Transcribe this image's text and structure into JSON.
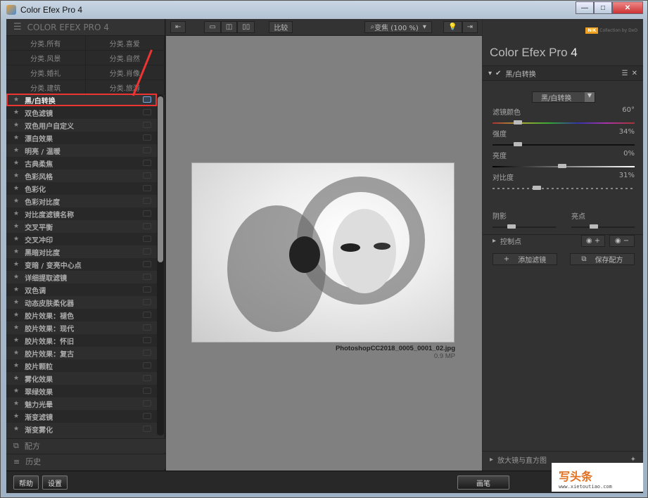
{
  "window": {
    "title": "Color Efex Pro 4",
    "minimize": "—",
    "maximize": "□",
    "close": "✕"
  },
  "left": {
    "header": "COLOR EFEX PRO 4",
    "categories": [
      "分类.所有",
      "分类.喜爱",
      "分类.风景",
      "分类.自然",
      "分类.婚礼",
      "分类.肖像",
      "分类.建筑",
      "分类.旅游"
    ],
    "filters": [
      "黑/白转换",
      "双色滤镜",
      "双色用户自定义",
      "漂白效果",
      "明亮 / 温暖",
      "古典柔焦",
      "色彩风格",
      "色彩化",
      "色彩对比度",
      "对比度滤镜名称",
      "交叉平衡",
      "交叉冲印",
      "黑暗对比度",
      "变暗 / 变亮中心点",
      "详细提取滤镜",
      "双色调",
      "动态皮肤柔化器",
      "胶片效果：褪色",
      "胶片效果：现代",
      "胶片效果：怀旧",
      "胶片效果：复古",
      "胶片颗粒",
      "雾化效果",
      "翠绿效果",
      "魅力光晕",
      "渐变滤镜",
      "渐变雾化"
    ],
    "selected_filter": "黑/白转换",
    "recipes": "配方",
    "history": "历史"
  },
  "toolbar": {
    "compare": "比较",
    "zoom": "变焦 (100 %)"
  },
  "image": {
    "filename": "PhotoshopCC2018_0005_0001_02.jpg",
    "size": "0.9 MP"
  },
  "right": {
    "brand": "NIK",
    "brand_sub": "Collection by DxO",
    "title": "Color Efex Pro",
    "title_num": "4",
    "filter_name": "黑/白转换",
    "method": "黑/白转换",
    "sliders": [
      {
        "label": "滤镜颜色",
        "value": "60°",
        "pos": 0.18
      },
      {
        "label": "强度",
        "value": "34%",
        "pos": 0.18
      },
      {
        "label": "亮度",
        "value": "0%",
        "pos": 0.49
      },
      {
        "label": "对比度",
        "value": "31%",
        "pos": 0.31
      }
    ],
    "shadows": {
      "label": "阴影",
      "pos": 0.3
    },
    "highlights": {
      "label": "亮点",
      "pos": 0.35
    },
    "control_points": "控制点",
    "add_filter": "添加滤镜",
    "save_recipe": "保存配方",
    "loupe": "放大镜与直方图"
  },
  "bottom": {
    "help": "帮助",
    "settings": "设置",
    "brush": "画笔"
  },
  "watermark": {
    "text": "写头条",
    "url": "www.xietoutiao.com"
  },
  "colors": {
    "selection_outline": "#e33333",
    "brand": "#f0a020"
  }
}
